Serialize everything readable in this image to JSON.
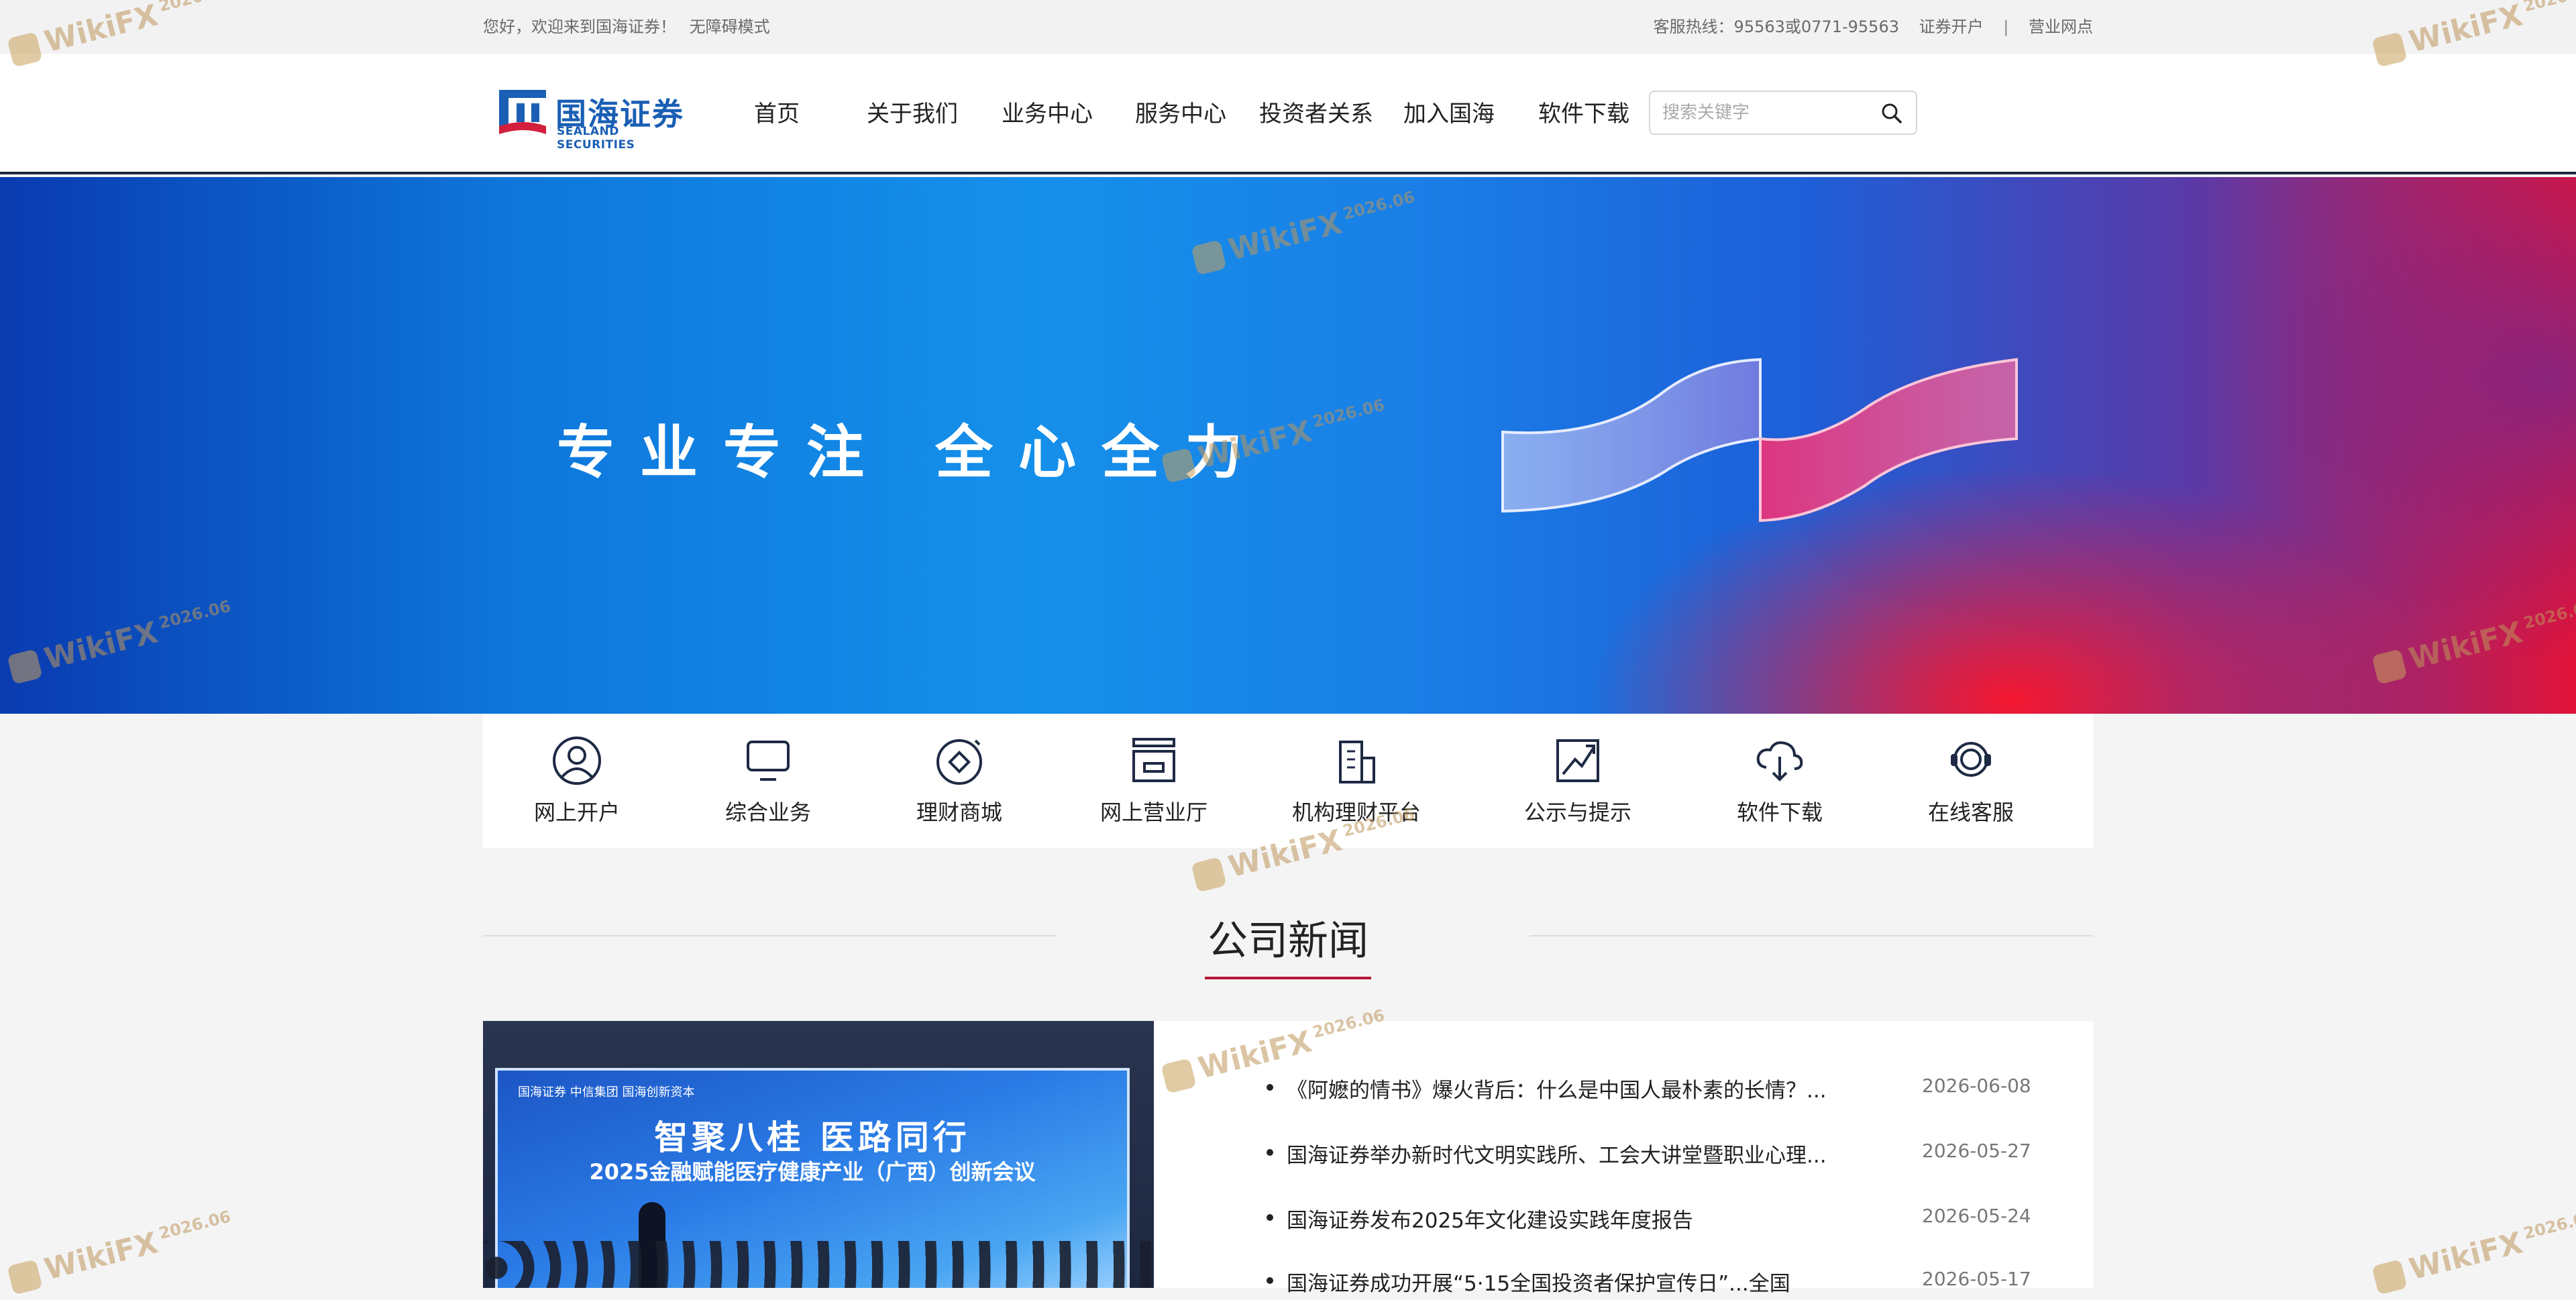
{
  "topbar": {
    "welcome": "您好，欢迎来到国海证券！",
    "accessibility": "无障碍模式",
    "hotline": "客服热线：95563或0771-95563",
    "open_account": "证券开户",
    "separator": "|",
    "branches": "营业网点"
  },
  "header": {
    "logo_cn": "国海证券",
    "logo_en": "SEALAND SECURITIES",
    "nav": [
      "首页",
      "关于我们",
      "业务中心",
      "服务中心",
      "投资者关系",
      "加入国海",
      "软件下载"
    ],
    "search_placeholder": "搜索关键字"
  },
  "banner": {
    "slogan": "专业专注 全心全力"
  },
  "quick_links": [
    {
      "label": "网上开户",
      "icon": "user-icon"
    },
    {
      "label": "综合业务",
      "icon": "monitor-icon"
    },
    {
      "label": "理财商城",
      "icon": "coin-icon"
    },
    {
      "label": "网上营业厅",
      "icon": "storefront-icon"
    },
    {
      "label": "机构理财平台",
      "icon": "building-icon"
    },
    {
      "label": "公示与提示",
      "icon": "trend-icon"
    },
    {
      "label": "软件下载",
      "icon": "cloud-download-icon"
    },
    {
      "label": "在线客服",
      "icon": "headset-icon"
    }
  ],
  "news_section": {
    "title": "公司新闻",
    "photo": {
      "headline": "智聚八桂 医路同行",
      "subline": "2025金融赋能医疗健康产业（广西）创新会议",
      "logos": "国海证券   中信集团   国海创新资本"
    },
    "items": [
      {
        "title": "《阿嬷的情书》爆火背后：什么是中国人最朴素的长情？...",
        "date": "2026-06-08"
      },
      {
        "title": "国海证券举办新时代文明实践所、工会大讲堂暨职业心理...",
        "date": "2026-05-27"
      },
      {
        "title": "国海证券发布2025年文化建设实践年度报告",
        "date": "2026-05-24"
      },
      {
        "title": "国海证券成功开展“5·15全国投资者保护宣传日”...全国",
        "date": "2026-05-17"
      }
    ]
  },
  "watermark": {
    "brand": "WikiFX",
    "year": "2026.06"
  },
  "colors": {
    "brand_blue": "#1a5fb4",
    "accent_red": "#b8173a",
    "nav_text": "#222222"
  }
}
